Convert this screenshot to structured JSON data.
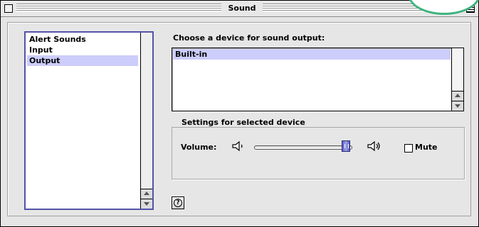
{
  "window": {
    "title": "Sound"
  },
  "categories": {
    "items": [
      {
        "label": "Alert Sounds",
        "selected": false
      },
      {
        "label": "Input",
        "selected": false
      },
      {
        "label": "Output",
        "selected": true
      }
    ]
  },
  "output_device": {
    "prompt": "Choose a device for sound output:",
    "devices": [
      {
        "label": "Built-in",
        "selected": true
      }
    ]
  },
  "settings": {
    "legend": "Settings for selected device",
    "volume_label": "Volume:",
    "volume_level": 0.95,
    "mute_label": "Mute",
    "mute_checked": false
  },
  "help": {
    "glyph": "?"
  },
  "icons": {
    "close_box": "close-box-icon",
    "collapse_box": "collapse-box-icon",
    "volume_low": "speaker-low-icon",
    "volume_high": "speaker-high-icon",
    "help": "help-icon"
  },
  "colors": {
    "selection": "#cccdfa",
    "list_border": "#5254a8",
    "slider_thumb": "#5a5ec4",
    "window_bg": "#e5e5e5"
  }
}
